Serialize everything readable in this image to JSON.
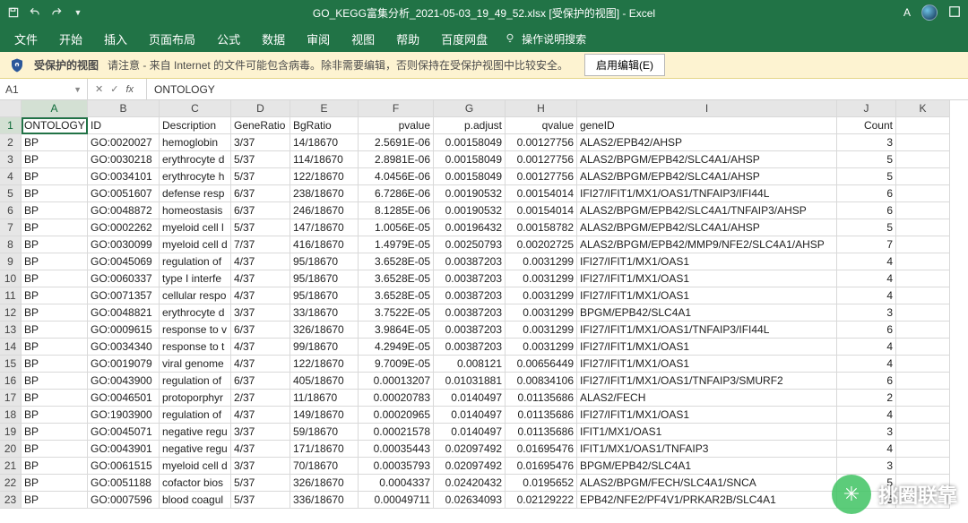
{
  "titlebar": {
    "title": "GO_KEGG富集分析_2021-05-03_19_49_52.xlsx  [受保护的视图]  -  Excel",
    "user_letter": "A"
  },
  "tabs": {
    "file": "文件",
    "home": "开始",
    "insert": "插入",
    "layout": "页面布局",
    "formulas": "公式",
    "data": "数据",
    "review": "审阅",
    "view": "视图",
    "help": "帮助",
    "baidu": "百度网盘",
    "tellme": "操作说明搜索"
  },
  "protected": {
    "label": "受保护的视图",
    "msg": "请注意 - 来自 Internet 的文件可能包含病毒。除非需要编辑，否则保持在受保护视图中比较安全。",
    "enable": "启用编辑(E)"
  },
  "namebox": "A1",
  "formula": "ONTOLOGY",
  "columns": [
    "A",
    "B",
    "C",
    "D",
    "E",
    "F",
    "G",
    "H",
    "I",
    "J",
    "K"
  ],
  "headers": [
    "ONTOLOGY",
    "ID",
    "Description",
    "GeneRatio",
    "BgRatio",
    "pvalue",
    "p.adjust",
    "qvalue",
    "geneID",
    "Count",
    ""
  ],
  "num_cols": {
    "5": 1,
    "6": 1,
    "7": 1,
    "9": 1
  },
  "chart_data": {
    "type": "table",
    "columns": [
      "ONTOLOGY",
      "ID",
      "Description",
      "GeneRatio",
      "BgRatio",
      "pvalue",
      "p.adjust",
      "qvalue",
      "geneID",
      "Count"
    ],
    "rows": [
      [
        "BP",
        "GO:0020027",
        "hemoglobin",
        "3/37",
        "14/18670",
        "2.5691E-06",
        "0.00158049",
        "0.00127756",
        "ALAS2/EPB42/AHSP",
        "3"
      ],
      [
        "BP",
        "GO:0030218",
        "erythrocyte d",
        "5/37",
        "114/18670",
        "2.8981E-06",
        "0.00158049",
        "0.00127756",
        "ALAS2/BPGM/EPB42/SLC4A1/AHSP",
        "5"
      ],
      [
        "BP",
        "GO:0034101",
        "erythrocyte h",
        "5/37",
        "122/18670",
        "4.0456E-06",
        "0.00158049",
        "0.00127756",
        "ALAS2/BPGM/EPB42/SLC4A1/AHSP",
        "5"
      ],
      [
        "BP",
        "GO:0051607",
        "defense resp",
        "6/37",
        "238/18670",
        "6.7286E-06",
        "0.00190532",
        "0.00154014",
        "IFI27/IFIT1/MX1/OAS1/TNFAIP3/IFI44L",
        "6"
      ],
      [
        "BP",
        "GO:0048872",
        "homeostasis",
        "6/37",
        "246/18670",
        "8.1285E-06",
        "0.00190532",
        "0.00154014",
        "ALAS2/BPGM/EPB42/SLC4A1/TNFAIP3/AHSP",
        "6"
      ],
      [
        "BP",
        "GO:0002262",
        "myeloid cell l",
        "5/37",
        "147/18670",
        "1.0056E-05",
        "0.00196432",
        "0.00158782",
        "ALAS2/BPGM/EPB42/SLC4A1/AHSP",
        "5"
      ],
      [
        "BP",
        "GO:0030099",
        "myeloid cell d",
        "7/37",
        "416/18670",
        "1.4979E-05",
        "0.00250793",
        "0.00202725",
        "ALAS2/BPGM/EPB42/MMP9/NFE2/SLC4A1/AHSP",
        "7"
      ],
      [
        "BP",
        "GO:0045069",
        "regulation of",
        "4/37",
        "95/18670",
        "3.6528E-05",
        "0.00387203",
        "0.0031299",
        "IFI27/IFIT1/MX1/OAS1",
        "4"
      ],
      [
        "BP",
        "GO:0060337",
        "type I interfe",
        "4/37",
        "95/18670",
        "3.6528E-05",
        "0.00387203",
        "0.0031299",
        "IFI27/IFIT1/MX1/OAS1",
        "4"
      ],
      [
        "BP",
        "GO:0071357",
        "cellular respo",
        "4/37",
        "95/18670",
        "3.6528E-05",
        "0.00387203",
        "0.0031299",
        "IFI27/IFIT1/MX1/OAS1",
        "4"
      ],
      [
        "BP",
        "GO:0048821",
        "erythrocyte d",
        "3/37",
        "33/18670",
        "3.7522E-05",
        "0.00387203",
        "0.0031299",
        "BPGM/EPB42/SLC4A1",
        "3"
      ],
      [
        "BP",
        "GO:0009615",
        "response to v",
        "6/37",
        "326/18670",
        "3.9864E-05",
        "0.00387203",
        "0.0031299",
        "IFI27/IFIT1/MX1/OAS1/TNFAIP3/IFI44L",
        "6"
      ],
      [
        "BP",
        "GO:0034340",
        "response to t",
        "4/37",
        "99/18670",
        "4.2949E-05",
        "0.00387203",
        "0.0031299",
        "IFI27/IFIT1/MX1/OAS1",
        "4"
      ],
      [
        "BP",
        "GO:0019079",
        "viral genome",
        "4/37",
        "122/18670",
        "9.7009E-05",
        "0.008121",
        "0.00656449",
        "IFI27/IFIT1/MX1/OAS1",
        "4"
      ],
      [
        "BP",
        "GO:0043900",
        "regulation of",
        "6/37",
        "405/18670",
        "0.00013207",
        "0.01031881",
        "0.00834106",
        "IFI27/IFIT1/MX1/OAS1/TNFAIP3/SMURF2",
        "6"
      ],
      [
        "BP",
        "GO:0046501",
        "protoporphyr",
        "2/37",
        "11/18670",
        "0.00020783",
        "0.0140497",
        "0.01135686",
        "ALAS2/FECH",
        "2"
      ],
      [
        "BP",
        "GO:1903900",
        "regulation of",
        "4/37",
        "149/18670",
        "0.00020965",
        "0.0140497",
        "0.01135686",
        "IFI27/IFIT1/MX1/OAS1",
        "4"
      ],
      [
        "BP",
        "GO:0045071",
        "negative regu",
        "3/37",
        "59/18670",
        "0.00021578",
        "0.0140497",
        "0.01135686",
        "IFIT1/MX1/OAS1",
        "3"
      ],
      [
        "BP",
        "GO:0043901",
        "negative regu",
        "4/37",
        "171/18670",
        "0.00035443",
        "0.02097492",
        "0.01695476",
        "IFIT1/MX1/OAS1/TNFAIP3",
        "4"
      ],
      [
        "BP",
        "GO:0061515",
        "myeloid cell d",
        "3/37",
        "70/18670",
        "0.00035793",
        "0.02097492",
        "0.01695476",
        "BPGM/EPB42/SLC4A1",
        "3"
      ],
      [
        "BP",
        "GO:0051188",
        "cofactor bios",
        "5/37",
        "326/18670",
        "0.0004337",
        "0.02420432",
        "0.0195652",
        "ALAS2/BPGM/FECH/SLC4A1/SNCA",
        "5"
      ],
      [
        "BP",
        "GO:0007596",
        "blood coagul",
        "5/37",
        "336/18670",
        "0.00049711",
        "0.02634093",
        "0.02129222",
        "EPB42/NFE2/PF4V1/PRKAR2B/SLC4A1",
        "5"
      ]
    ]
  },
  "watermark": "挑圈联靠"
}
